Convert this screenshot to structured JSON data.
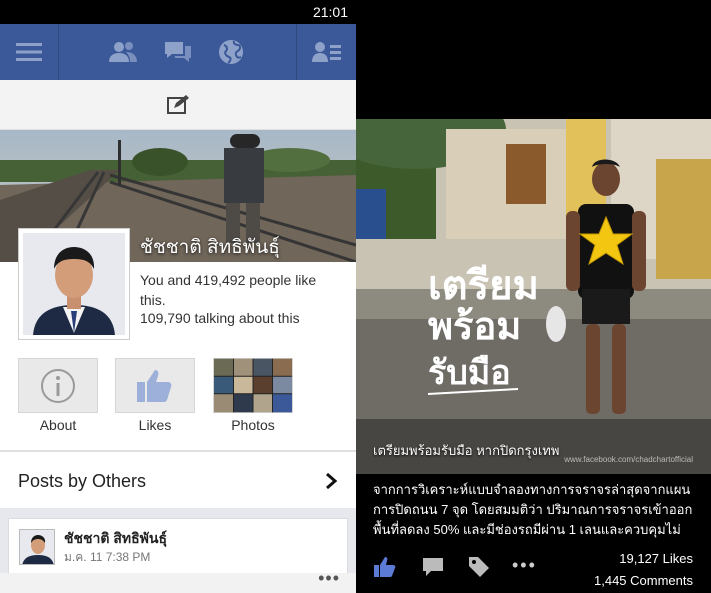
{
  "status": {
    "time": "21:01"
  },
  "navbar": {
    "icons": [
      "menu-icon",
      "friends-icon",
      "messages-icon",
      "globe-icon",
      "friend-requests-icon"
    ]
  },
  "page": {
    "name": "ชัชชาติ สิทธิพันธุ์",
    "likes_text": "You and 419,492 people like this.",
    "talking_text": "109,790 talking about this"
  },
  "tiles": [
    {
      "label": "About",
      "icon": "info-icon"
    },
    {
      "label": "Likes",
      "icon": "thumbs-up-icon"
    },
    {
      "label": "Photos",
      "icon": "photos-grid"
    }
  ],
  "posts": {
    "header": "Posts by Others",
    "items": [
      {
        "author": "ชัชชาติ สิทธิพันธุ์",
        "time": "ม.ค. 11 7:38 PM"
      }
    ]
  },
  "photo_view": {
    "image_text": [
      "เตรียม",
      "พร้อม",
      "รับมือ"
    ],
    "caption": "เตรียมพร้อมรับมือ หากปิดกรุงเทพ",
    "watermark": "www.facebook.com/chadchartofficial",
    "description_lines": [
      "จากการวิเคราะห์แบบจำลองทางการจราจรล่าสุดจากแผน",
      "การปิดถนน 7 จุด โดยสมมติว่า ปริมาณการจราจรเข้าออก",
      "พื้นที่ลดลง 50% และมีช่องรถมีผ่าน 1 เลนและควบคุมไม่"
    ],
    "likes": "19,127 Likes",
    "comments": "1,445 Comments"
  },
  "colors": {
    "facebook_blue": "#3b5998",
    "like_blue": "#5b7bd5"
  }
}
